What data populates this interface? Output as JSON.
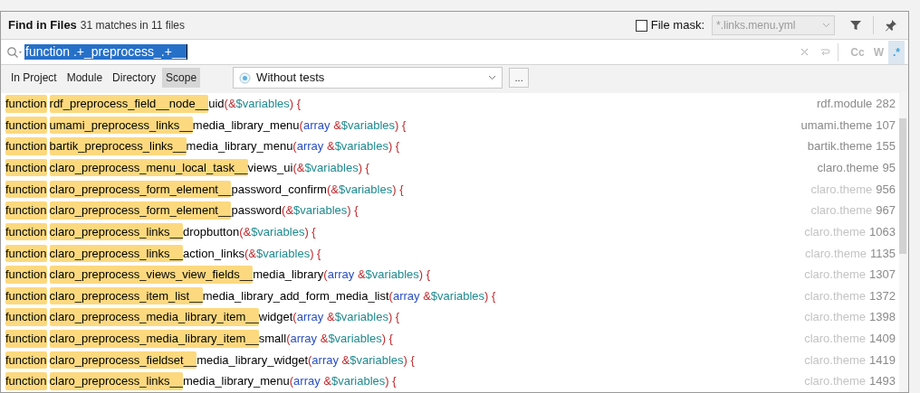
{
  "header": {
    "title": "Find in Files",
    "summary": "31 matches in 11 files",
    "file_mask": {
      "checked": false,
      "label": "File mask:",
      "value": "*.links.menu.yml",
      "disabled": true
    }
  },
  "search": {
    "value": "function .+_preprocess_.+__",
    "options": [
      {
        "label": "Cc",
        "selected": false
      },
      {
        "label": "W",
        "selected": false
      },
      {
        "label": ".*",
        "selected": true
      }
    ]
  },
  "scope_tabs": [
    {
      "label": "In Project",
      "selected": false
    },
    {
      "label": "Module",
      "selected": false
    },
    {
      "label": "Directory",
      "selected": false
    },
    {
      "label": "Scope",
      "selected": true
    }
  ],
  "scope_select": {
    "value": "Without tests",
    "more": "..."
  },
  "results": [
    {
      "tokens": [
        {
          "kind": "match",
          "text": "function"
        },
        {
          "kind": "match",
          "text": "rdf_preprocess_field__node__"
        },
        {
          "kind": "plain",
          "text": "uid"
        },
        {
          "kind": "punct",
          "text": "(&"
        },
        {
          "kind": "variable",
          "text": "$variables"
        },
        {
          "kind": "punct",
          "text": ") {"
        }
      ],
      "file": "rdf.module",
      "line": "282",
      "dimmed": false
    },
    {
      "tokens": [
        {
          "kind": "match",
          "text": "function"
        },
        {
          "kind": "match",
          "text": "umami_preprocess_links__"
        },
        {
          "kind": "plain",
          "text": "media_library_menu"
        },
        {
          "kind": "punct",
          "text": "("
        },
        {
          "kind": "keyword",
          "text": "array"
        },
        {
          "kind": "punct",
          "text": " &"
        },
        {
          "kind": "variable",
          "text": "$variables"
        },
        {
          "kind": "punct",
          "text": ") {"
        }
      ],
      "file": "umami.theme",
      "line": "107",
      "dimmed": false
    },
    {
      "tokens": [
        {
          "kind": "match",
          "text": "function"
        },
        {
          "kind": "match",
          "text": "bartik_preprocess_links__"
        },
        {
          "kind": "plain",
          "text": "media_library_menu"
        },
        {
          "kind": "punct",
          "text": "("
        },
        {
          "kind": "keyword",
          "text": "array"
        },
        {
          "kind": "punct",
          "text": " &"
        },
        {
          "kind": "variable",
          "text": "$variables"
        },
        {
          "kind": "punct",
          "text": ") {"
        }
      ],
      "file": "bartik.theme",
      "line": "155",
      "dimmed": false
    },
    {
      "tokens": [
        {
          "kind": "match",
          "text": "function"
        },
        {
          "kind": "match",
          "text": "claro_preprocess_menu_local_task__"
        },
        {
          "kind": "plain",
          "text": "views_ui"
        },
        {
          "kind": "punct",
          "text": "(&"
        },
        {
          "kind": "variable",
          "text": "$variables"
        },
        {
          "kind": "punct",
          "text": ") {"
        }
      ],
      "file": "claro.theme",
      "line": "95",
      "dimmed": false
    },
    {
      "tokens": [
        {
          "kind": "match",
          "text": "function"
        },
        {
          "kind": "match",
          "text": "claro_preprocess_form_element__"
        },
        {
          "kind": "plain",
          "text": "password_confirm"
        },
        {
          "kind": "punct",
          "text": "(&"
        },
        {
          "kind": "variable",
          "text": "$variables"
        },
        {
          "kind": "punct",
          "text": ") {"
        }
      ],
      "file": "claro.theme",
      "line": "956",
      "dimmed": true
    },
    {
      "tokens": [
        {
          "kind": "match",
          "text": "function"
        },
        {
          "kind": "match",
          "text": "claro_preprocess_form_element__"
        },
        {
          "kind": "plain",
          "text": "password"
        },
        {
          "kind": "punct",
          "text": "(&"
        },
        {
          "kind": "variable",
          "text": "$variables"
        },
        {
          "kind": "punct",
          "text": ") {"
        }
      ],
      "file": "claro.theme",
      "line": "967",
      "dimmed": true
    },
    {
      "tokens": [
        {
          "kind": "match",
          "text": "function"
        },
        {
          "kind": "match",
          "text": "claro_preprocess_links__"
        },
        {
          "kind": "plain",
          "text": "dropbutton"
        },
        {
          "kind": "punct",
          "text": "(&"
        },
        {
          "kind": "variable",
          "text": "$variables"
        },
        {
          "kind": "punct",
          "text": ") {"
        }
      ],
      "file": "claro.theme",
      "line": "1063",
      "dimmed": true
    },
    {
      "tokens": [
        {
          "kind": "match",
          "text": "function"
        },
        {
          "kind": "match",
          "text": "claro_preprocess_links__"
        },
        {
          "kind": "plain",
          "text": "action_links"
        },
        {
          "kind": "punct",
          "text": "(&"
        },
        {
          "kind": "variable",
          "text": "$variables"
        },
        {
          "kind": "punct",
          "text": ") {"
        }
      ],
      "file": "claro.theme",
      "line": "1135",
      "dimmed": true
    },
    {
      "tokens": [
        {
          "kind": "match",
          "text": "function"
        },
        {
          "kind": "match",
          "text": "claro_preprocess_views_view_fields__"
        },
        {
          "kind": "plain",
          "text": "media_library"
        },
        {
          "kind": "punct",
          "text": "("
        },
        {
          "kind": "keyword",
          "text": "array"
        },
        {
          "kind": "punct",
          "text": " &"
        },
        {
          "kind": "variable",
          "text": "$variables"
        },
        {
          "kind": "punct",
          "text": ") {"
        }
      ],
      "file": "claro.theme",
      "line": "1307",
      "dimmed": true
    },
    {
      "tokens": [
        {
          "kind": "match",
          "text": "function"
        },
        {
          "kind": "match",
          "text": "claro_preprocess_item_list__"
        },
        {
          "kind": "plain",
          "text": "media_library_add_form_media_list"
        },
        {
          "kind": "punct",
          "text": "("
        },
        {
          "kind": "keyword",
          "text": "array"
        },
        {
          "kind": "punct",
          "text": " &"
        },
        {
          "kind": "variable",
          "text": "$variables"
        },
        {
          "kind": "punct",
          "text": ") {"
        }
      ],
      "file": "claro.theme",
      "line": "1372",
      "dimmed": true
    },
    {
      "tokens": [
        {
          "kind": "match",
          "text": "function"
        },
        {
          "kind": "match",
          "text": "claro_preprocess_media_library_item__"
        },
        {
          "kind": "plain",
          "text": "widget"
        },
        {
          "kind": "punct",
          "text": "("
        },
        {
          "kind": "keyword",
          "text": "array"
        },
        {
          "kind": "punct",
          "text": " &"
        },
        {
          "kind": "variable",
          "text": "$variables"
        },
        {
          "kind": "punct",
          "text": ") {"
        }
      ],
      "file": "claro.theme",
      "line": "1398",
      "dimmed": true
    },
    {
      "tokens": [
        {
          "kind": "match",
          "text": "function"
        },
        {
          "kind": "match",
          "text": "claro_preprocess_media_library_item__"
        },
        {
          "kind": "plain",
          "text": "small"
        },
        {
          "kind": "punct",
          "text": "("
        },
        {
          "kind": "keyword",
          "text": "array"
        },
        {
          "kind": "punct",
          "text": " &"
        },
        {
          "kind": "variable",
          "text": "$variables"
        },
        {
          "kind": "punct",
          "text": ") {"
        }
      ],
      "file": "claro.theme",
      "line": "1409",
      "dimmed": true
    },
    {
      "tokens": [
        {
          "kind": "match",
          "text": "function"
        },
        {
          "kind": "match",
          "text": "claro_preprocess_fieldset__"
        },
        {
          "kind": "plain",
          "text": "media_library_widget"
        },
        {
          "kind": "punct",
          "text": "("
        },
        {
          "kind": "keyword",
          "text": "array"
        },
        {
          "kind": "punct",
          "text": " &"
        },
        {
          "kind": "variable",
          "text": "$variables"
        },
        {
          "kind": "punct",
          "text": ") {"
        }
      ],
      "file": "claro.theme",
      "line": "1419",
      "dimmed": true
    },
    {
      "tokens": [
        {
          "kind": "match",
          "text": "function"
        },
        {
          "kind": "match",
          "text": "claro_preprocess_links__"
        },
        {
          "kind": "plain",
          "text": "media_library_menu"
        },
        {
          "kind": "punct",
          "text": "("
        },
        {
          "kind": "keyword",
          "text": "array"
        },
        {
          "kind": "punct",
          "text": " &"
        },
        {
          "kind": "variable",
          "text": "$variables"
        },
        {
          "kind": "punct",
          "text": ") {"
        }
      ],
      "file": "claro.theme",
      "line": "1493",
      "dimmed": true
    }
  ]
}
